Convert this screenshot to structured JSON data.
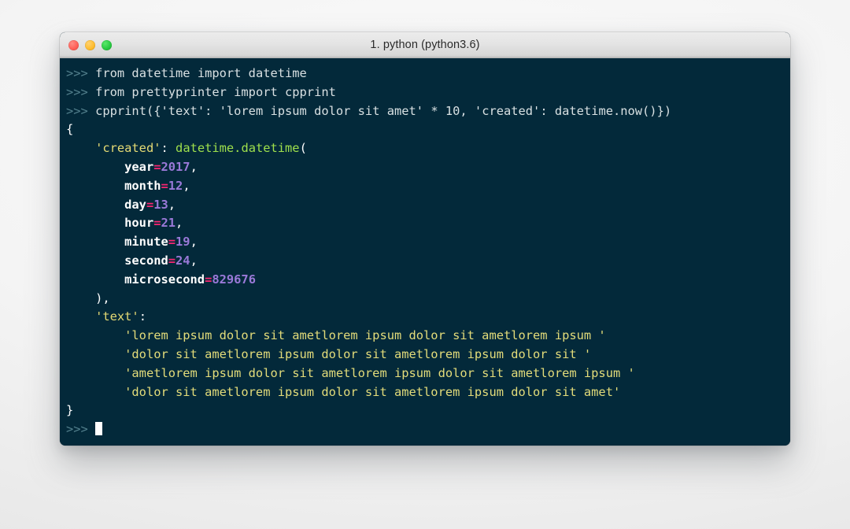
{
  "window": {
    "title": "1. python (python3.6)",
    "controls": [
      {
        "name": "close-button",
        "color": "#ff5f57"
      },
      {
        "name": "minimize-button",
        "color": "#febc2e"
      },
      {
        "name": "maximize-button",
        "color": "#28c840"
      }
    ]
  },
  "theme": {
    "background": "#03293a",
    "foreground": "#d8e0e2",
    "prompt": "#527f8c",
    "string": "#e3dc7a",
    "key": "#e6db74",
    "function": "#9fe04c",
    "operator": "#f72672",
    "number": "#9a79d8",
    "titlebar": "#e4e4e4"
  },
  "terminal": {
    "prompt_symbol": ">>>",
    "input_lines": [
      "from datetime import datetime",
      "from prettyprinter import cpprint",
      "cpprint({'text': 'lorem ipsum dolor sit amet' * 10, 'created': datetime.now()})"
    ],
    "output": {
      "open_brace": "{",
      "close_brace": "}",
      "created_key": "'created'",
      "created_colon": ":",
      "created_call": "datetime.datetime",
      "call_open": "(",
      "call_close": ")",
      "call_close_comma": "),",
      "datetime_args": [
        {
          "name": "year",
          "eq": "=",
          "value": "2017",
          "comma": ","
        },
        {
          "name": "month",
          "eq": "=",
          "value": "12",
          "comma": ","
        },
        {
          "name": "day",
          "eq": "=",
          "value": "13",
          "comma": ","
        },
        {
          "name": "hour",
          "eq": "=",
          "value": "21",
          "comma": ","
        },
        {
          "name": "minute",
          "eq": "=",
          "value": "19",
          "comma": ","
        },
        {
          "name": "second",
          "eq": "=",
          "value": "24",
          "comma": ","
        },
        {
          "name": "microsecond",
          "eq": "=",
          "value": "829676",
          "comma": ""
        }
      ],
      "text_key": "'text'",
      "text_colon": ":",
      "text_lines": [
        "'lorem ipsum dolor sit ametlorem ipsum dolor sit ametlorem ipsum '",
        "'dolor sit ametlorem ipsum dolor sit ametlorem ipsum dolor sit '",
        "'ametlorem ipsum dolor sit ametlorem ipsum dolor sit ametlorem ipsum '",
        "'dolor sit ametlorem ipsum dolor sit ametlorem ipsum dolor sit amet'"
      ]
    }
  }
}
